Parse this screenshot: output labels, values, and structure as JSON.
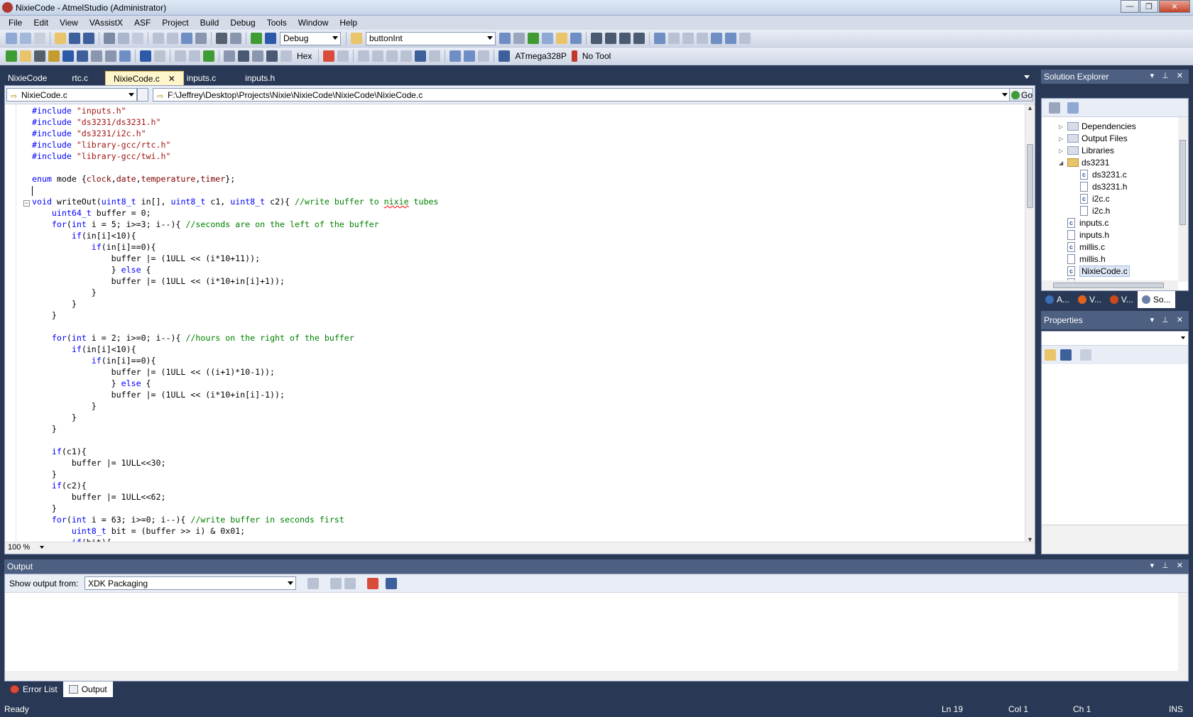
{
  "window": {
    "title": "NixieCode - AtmelStudio (Administrator)",
    "minimize": "—",
    "maximize": "❐",
    "close": "✕"
  },
  "menu": [
    "File",
    "Edit",
    "View",
    "VAssistX",
    "ASF",
    "Project",
    "Build",
    "Debug",
    "Tools",
    "Window",
    "Help"
  ],
  "toolbar": {
    "config": "Debug",
    "find_value": "buttonInt",
    "hex_label": "Hex",
    "device": "ATmega328P",
    "tool": "No Tool"
  },
  "tabs": [
    {
      "label": "NixieCode",
      "active": false
    },
    {
      "label": "rtc.c",
      "active": false
    },
    {
      "label": "NixieCode.c",
      "active": true
    },
    {
      "label": "inputs.c",
      "active": false
    },
    {
      "label": "inputs.h",
      "active": false
    }
  ],
  "tab_close": "✕",
  "editor": {
    "nav_file": "NixieCode.c",
    "path": "F:\\Jeffrey\\Desktop\\Projects\\Nixie\\NixieCode\\NixieCode\\NixieCode.c",
    "go_label": "Go",
    "zoom": "100 %"
  },
  "solution": {
    "title": "Solution Explorer",
    "items": [
      {
        "label": "Dependencies",
        "kind": "folder-plain",
        "expander": "▷",
        "indent": 0
      },
      {
        "label": "Output Files",
        "kind": "folder-plain",
        "expander": "▷",
        "indent": 0
      },
      {
        "label": "Libraries",
        "kind": "folder-plain",
        "expander": "▷",
        "indent": 0
      },
      {
        "label": "ds3231",
        "kind": "folder",
        "expander": "◢",
        "indent": 0
      },
      {
        "label": "ds3231.c",
        "kind": "c",
        "expander": "",
        "indent": 1
      },
      {
        "label": "ds3231.h",
        "kind": "h",
        "expander": "",
        "indent": 1
      },
      {
        "label": "i2c.c",
        "kind": "c",
        "expander": "",
        "indent": 1
      },
      {
        "label": "i2c.h",
        "kind": "h",
        "expander": "",
        "indent": 1
      },
      {
        "label": "inputs.c",
        "kind": "c",
        "expander": "",
        "indent": 0
      },
      {
        "label": "inputs.h",
        "kind": "h",
        "expander": "",
        "indent": 0
      },
      {
        "label": "millis.c",
        "kind": "c",
        "expander": "",
        "indent": 0
      },
      {
        "label": "millis.h",
        "kind": "h",
        "expander": "",
        "indent": 0
      },
      {
        "label": "NixieCode.c",
        "kind": "c",
        "expander": "",
        "indent": 0,
        "selected": true
      },
      {
        "label": "rtc.c",
        "kind": "c",
        "expander": "",
        "indent": 0
      }
    ],
    "bottom_tabs": [
      {
        "label": "A...",
        "color": "#3b6fb6",
        "active": false
      },
      {
        "label": "V...",
        "color": "#e0621e",
        "active": false
      },
      {
        "label": "V...",
        "color": "#c94a1c",
        "active": false
      },
      {
        "label": "So...",
        "color": "#6d7fa3",
        "active": true
      }
    ]
  },
  "properties": {
    "title": "Properties"
  },
  "output": {
    "title": "Output",
    "show_from_label": "Show output from:",
    "source": "XDK Packaging"
  },
  "bottom_tabs": [
    {
      "label": "Error List",
      "icon": "err",
      "active": false
    },
    {
      "label": "Output",
      "icon": "out",
      "active": true
    }
  ],
  "status": {
    "ready": "Ready",
    "ln": "Ln 19",
    "col": "Col 1",
    "ch": "Ch 1",
    "mode": "INS"
  },
  "code": [
    "#include \"inputs.h\"",
    "#include \"ds3231/ds3231.h\"",
    "#include \"ds3231/i2c.h\"",
    "#include \"library-gcc/rtc.h\"",
    "#include \"library-gcc/twi.h\"",
    "",
    "enum mode {clock,date,temperature,timer};",
    "",
    "void writeOut(uint8_t in[], uint8_t c1, uint8_t c2){ //write buffer to nixie tubes",
    "    uint64_t buffer = 0;",
    "    for(int i = 5; i>=3; i--){ //seconds are on the left of the buffer",
    "        if(in[i]<10){",
    "            if(in[i]==0){",
    "                buffer |= (1ULL << (i*10+11));",
    "                } else {",
    "                buffer |= (1ULL << (i*10+in[i]+1));",
    "            }",
    "        }",
    "    }",
    "",
    "    for(int i = 2; i>=0; i--){ //hours on the right of the buffer",
    "        if(in[i]<10){",
    "            if(in[i]==0){",
    "                buffer |= (1ULL << ((i+1)*10-1));",
    "                } else {",
    "                buffer |= (1ULL << (i*10+in[i]-1));",
    "            }",
    "        }",
    "    }",
    "",
    "    if(c1){",
    "        buffer |= 1ULL<<30;",
    "    }",
    "    if(c2){",
    "        buffer |= 1ULL<<62;",
    "    }",
    "    for(int i = 63; i>=0; i--){ //write buffer in seconds first",
    "        uint8_t bit = (buffer >> i) & 0x01;",
    "        if(bit){"
  ]
}
